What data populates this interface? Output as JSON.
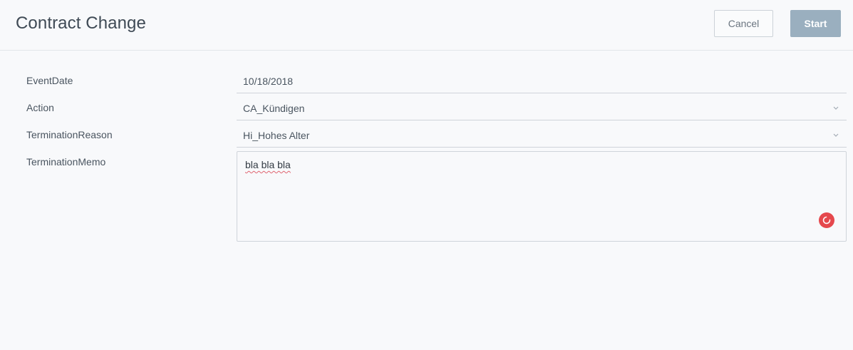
{
  "header": {
    "title": "Contract Change",
    "cancel_label": "Cancel",
    "start_label": "Start"
  },
  "form": {
    "fields": [
      {
        "label": "EventDate",
        "value": "10/18/2018"
      },
      {
        "label": "Action",
        "value": "CA_Kündigen"
      },
      {
        "label": "TerminationReason",
        "value": "Hi_Hohes Alter"
      },
      {
        "label": "TerminationMemo",
        "value": "bla bla bla"
      }
    ]
  },
  "icons": {
    "dropdown": "chevron-down-icon",
    "spellcheck": "grammar-checker-icon"
  },
  "colors": {
    "start_button": "#9aafbf",
    "spellcheck_badge": "#e5484d"
  }
}
